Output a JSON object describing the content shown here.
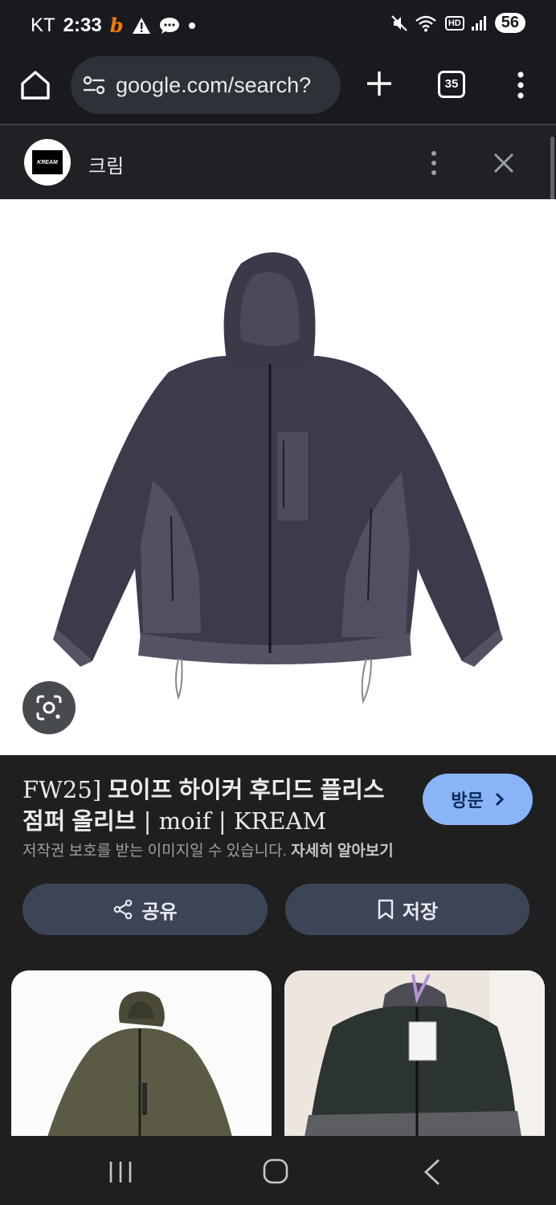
{
  "status_bar": {
    "carrier": "KT",
    "time": "2:33",
    "notif_icon": "b",
    "battery": "56",
    "hd_label": "HD",
    "signal_label": "5"
  },
  "chrome": {
    "url": "google.com/search?",
    "tab_count": "35"
  },
  "site": {
    "name": "크림",
    "logo_text": "KREAM"
  },
  "result": {
    "title_prefix": "FW25]",
    "title_main": "모이프 하이커 후디드 플리스 점퍼 올리브",
    "title_suffix": " | moif | KREAM",
    "visit_label": "방문",
    "copyright_text": "저작권 보호를 받는 이미지일 수 있습니다.",
    "learn_more": "자세히 알아보기",
    "share_label": "공유",
    "save_label": "저장"
  },
  "colors": {
    "background": "#1f1f1f",
    "accent": "#8ab4f8",
    "button": "#3c4556",
    "jacket": "#3a3a4a"
  }
}
